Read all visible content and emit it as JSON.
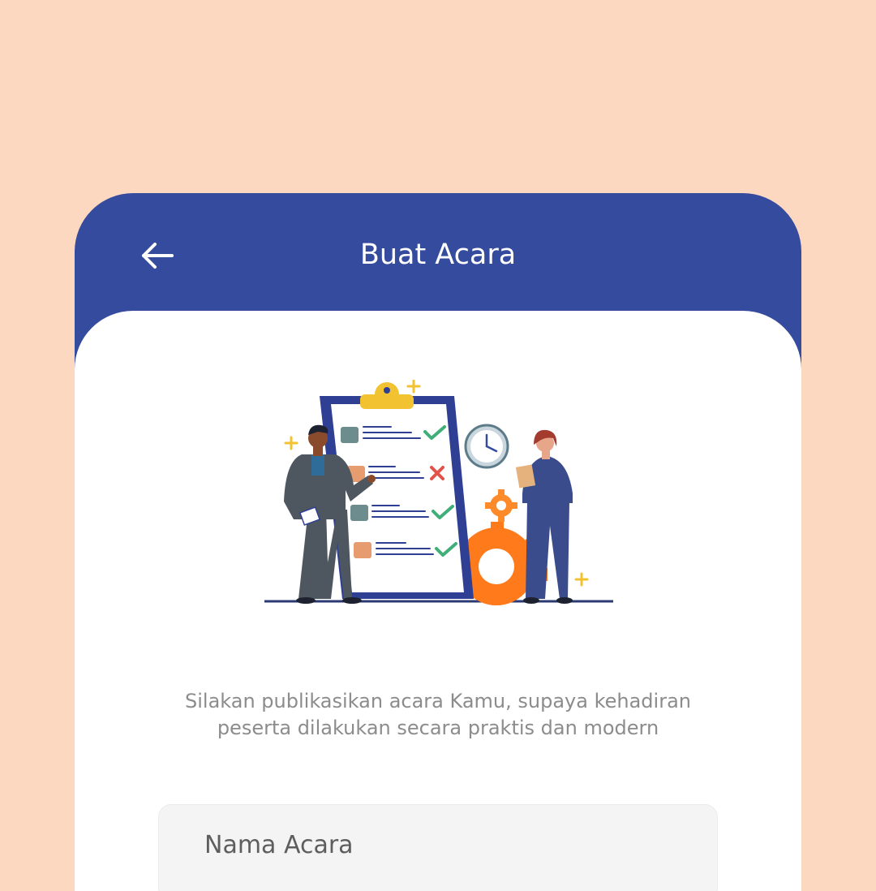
{
  "header": {
    "back_icon": "arrow-left-icon",
    "title": "Buat Acara"
  },
  "main": {
    "illustration": "checklist-illustration",
    "description_line1": "Silakan publikasikan acara Kamu, supaya kehadiran",
    "description_line2": "peserta dilakukan secara praktis dan modern"
  },
  "form": {
    "event_name_placeholder": "Nama Acara"
  },
  "colors": {
    "page_background": "#FDD8C1",
    "header_blue": "#354B9E",
    "card_white": "#FFFFFF",
    "input_background": "#F4F4F4",
    "muted_text": "#8C8C8C",
    "accent_orange": "#FF7A1A",
    "accent_yellow": "#F2C230"
  }
}
